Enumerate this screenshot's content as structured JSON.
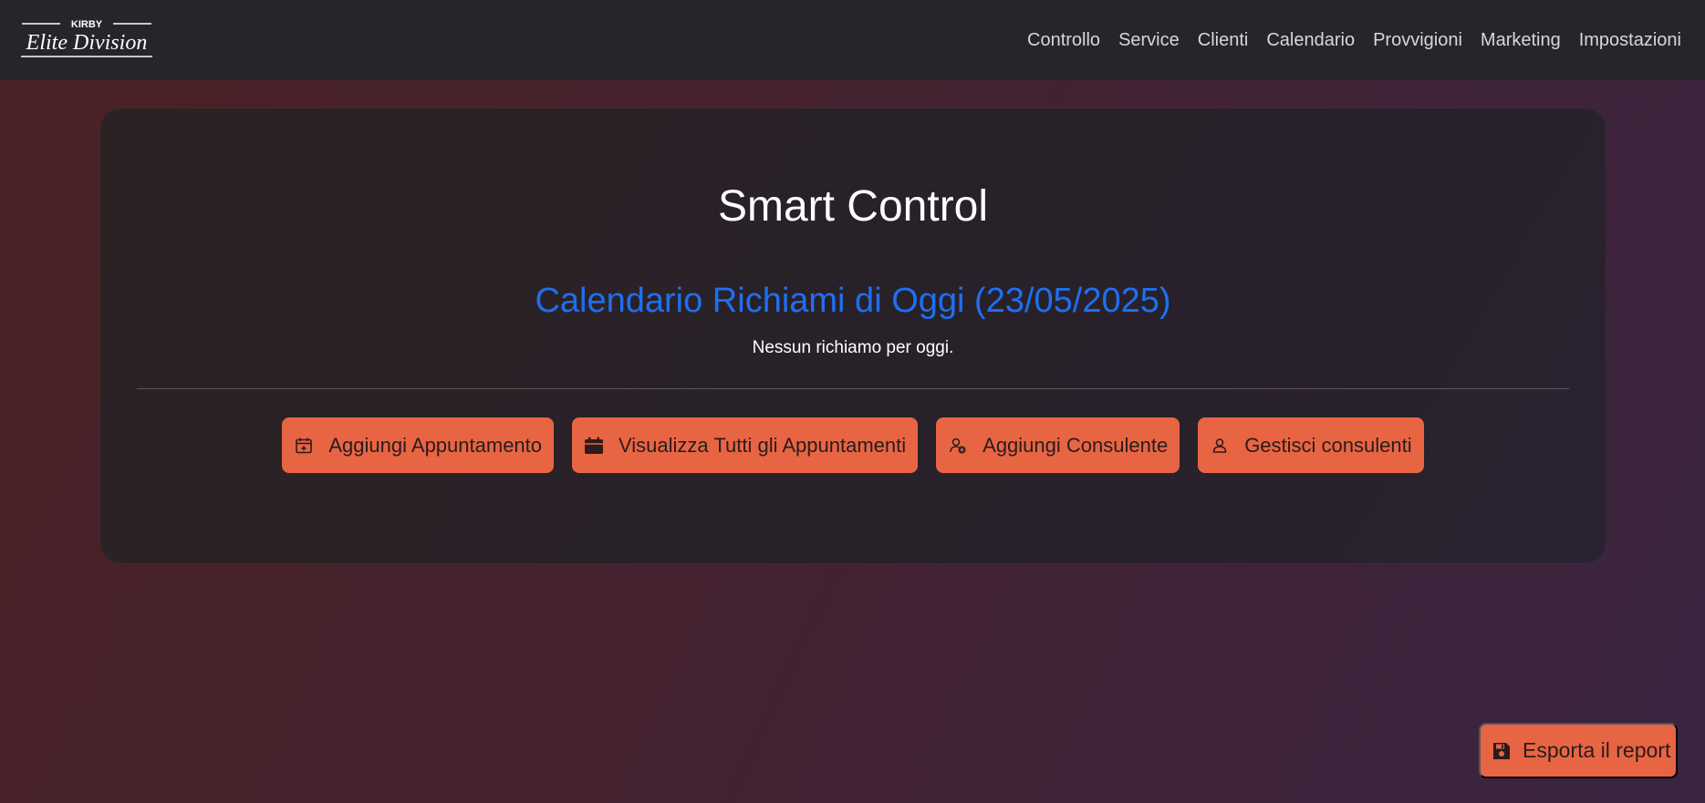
{
  "brand": {
    "top_text": "KIRBY",
    "script_text": "Elite Division"
  },
  "nav": {
    "items": [
      {
        "label": "Controllo"
      },
      {
        "label": "Service"
      },
      {
        "label": "Clienti"
      },
      {
        "label": "Calendario"
      },
      {
        "label": "Provvigioni"
      },
      {
        "label": "Marketing"
      },
      {
        "label": "Impostazioni"
      }
    ]
  },
  "main": {
    "title": "Smart Control",
    "subtitle": "Calendario Richiami di Oggi (23/05/2025)",
    "empty_message": "Nessun richiamo per oggi.",
    "actions": [
      {
        "label": "Aggiungi Appuntamento",
        "icon": "calendar-plus-icon"
      },
      {
        "label": "Visualizza Tutti gli Appuntamenti",
        "icon": "calendar-icon"
      },
      {
        "label": "Aggiungi Consulente",
        "icon": "person-plus-icon"
      },
      {
        "label": "Gestisci consulenti",
        "icon": "person-icon"
      }
    ]
  },
  "export": {
    "label": "Esporta il report",
    "icon": "save-icon"
  },
  "colors": {
    "navbar": "#242629",
    "accent_button": "#e86543",
    "subtitle_blue": "#1f6ff0",
    "card_bg": "#2a2129"
  }
}
